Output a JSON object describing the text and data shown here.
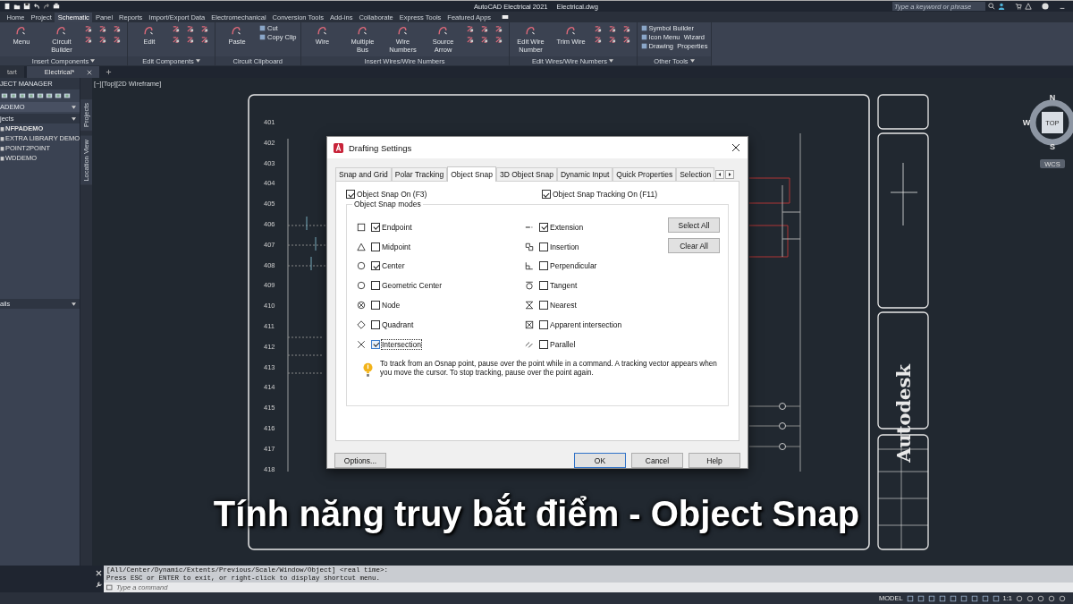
{
  "title_bar": {
    "app_title": "AutoCAD Electrical 2021",
    "file_name": "Electrical.dwg",
    "search": {
      "placeholder": "Type a keyword or phrase"
    }
  },
  "ribbon_tabs": [
    {
      "label": "Home",
      "selected": false
    },
    {
      "label": "Project",
      "selected": false
    },
    {
      "label": "Schematic",
      "selected": true
    },
    {
      "label": "Panel",
      "selected": false
    },
    {
      "label": "Reports",
      "selected": false
    },
    {
      "label": "Import/Export Data",
      "selected": false
    },
    {
      "label": "Electromechanical",
      "selected": false
    },
    {
      "label": "Conversion Tools",
      "selected": false
    },
    {
      "label": "Add-ins",
      "selected": false
    },
    {
      "label": "Collaborate",
      "selected": false
    },
    {
      "label": "Express Tools",
      "selected": false
    },
    {
      "label": "Featured Apps",
      "selected": false
    }
  ],
  "ribbon_panels": [
    {
      "title": "Insert Components",
      "menu": true,
      "tools": [
        {
          "kind": "large",
          "label": "Menu"
        },
        {
          "kind": "large",
          "label": "Circuit Builder"
        },
        {
          "kind": "grid"
        }
      ]
    },
    {
      "title": "Edit Components",
      "menu": true,
      "tools": [
        {
          "kind": "large",
          "label": "Edit"
        },
        {
          "kind": "grid"
        }
      ]
    },
    {
      "title": "Circuit Clipboard",
      "menu": false,
      "tools": [
        {
          "kind": "large",
          "label": "Paste"
        },
        {
          "kind": "stack",
          "items": [
            "Cut",
            "Copy Clip"
          ]
        }
      ]
    },
    {
      "title": "Insert Wires/Wire Numbers",
      "menu": false,
      "tools": [
        {
          "kind": "large",
          "label": "Wire"
        },
        {
          "kind": "large",
          "label": "Multiple Bus"
        },
        {
          "kind": "large",
          "label": "Wire Numbers"
        },
        {
          "kind": "large",
          "label": "Source Arrow"
        },
        {
          "kind": "grid"
        }
      ]
    },
    {
      "title": "Edit Wires/Wire Numbers",
      "menu": true,
      "tools": [
        {
          "kind": "large",
          "label": "Edit Wire Number"
        },
        {
          "kind": "large",
          "label": "Trim Wire"
        },
        {
          "kind": "grid"
        }
      ]
    },
    {
      "title": "Other Tools",
      "menu": true,
      "tools": [
        {
          "kind": "stack",
          "items": [
            "Symbol Builder",
            "Icon Menu  Wizard",
            "Drawing  Properties"
          ]
        }
      ]
    }
  ],
  "doc_tabs": [
    {
      "label": "tart",
      "selected": false
    },
    {
      "label": "Electrical*",
      "selected": true
    }
  ],
  "project_manager": {
    "title": "JECT MANAGER",
    "project": "ADEMO",
    "section": "jects",
    "projects": [
      {
        "label": "NFPADEMO",
        "selected": true
      },
      {
        "label": "EXTRA LIBRARY DEMO",
        "selected": false
      },
      {
        "label": "POINT2POINT",
        "selected": false
      },
      {
        "label": "WDDEMO",
        "selected": false
      }
    ],
    "details_title": "ails"
  },
  "side_tabs": [
    "Projects",
    "Location View"
  ],
  "viewport": {
    "label": "[−][Top][2D Wireframe]",
    "sheet_line_numbers": [
      "401",
      "402",
      "403",
      "404",
      "405",
      "406",
      "407",
      "408",
      "409",
      "410",
      "411",
      "412",
      "413",
      "414",
      "415",
      "416",
      "417",
      "418"
    ],
    "title_block_text": "Autodesk"
  },
  "view_cube": {
    "north": "N",
    "south": "S",
    "west": "W",
    "face": "TOP",
    "ucs": "WCS"
  },
  "dialog": {
    "title": "Drafting Settings",
    "tabs": [
      {
        "label": "Snap and Grid",
        "selected": false
      },
      {
        "label": "Polar Tracking",
        "selected": false
      },
      {
        "label": "Object Snap",
        "selected": true
      },
      {
        "label": "3D Object Snap",
        "selected": false
      },
      {
        "label": "Dynamic Input",
        "selected": false
      },
      {
        "label": "Quick Properties",
        "selected": false
      },
      {
        "label": "Selection",
        "selected": false
      }
    ],
    "snap_on": {
      "label": "Object Snap On (F3)",
      "checked": true
    },
    "tracking_on": {
      "label": "Object Snap Tracking On (F11)",
      "checked": true
    },
    "group_title": "Object Snap modes",
    "modes": [
      {
        "kind": "endpoint",
        "label": "Endpoint",
        "checked": true,
        "focused": false
      },
      {
        "kind": "midpoint",
        "label": "Midpoint",
        "checked": false,
        "focused": false
      },
      {
        "kind": "center",
        "label": "Center",
        "checked": true,
        "focused": false
      },
      {
        "kind": "geometric",
        "label": "Geometric Center",
        "checked": false,
        "focused": false
      },
      {
        "kind": "node",
        "label": "Node",
        "checked": false,
        "focused": false
      },
      {
        "kind": "quadrant",
        "label": "Quadrant",
        "checked": false,
        "focused": false
      },
      {
        "kind": "intersection",
        "label": "Intersection",
        "checked": true,
        "focused": true
      },
      {
        "kind": "extension",
        "label": "Extension",
        "checked": true,
        "focused": false
      },
      {
        "kind": "insertion",
        "label": "Insertion",
        "checked": false,
        "focused": false
      },
      {
        "kind": "perpendicular",
        "label": "Perpendicular",
        "checked": false,
        "focused": false
      },
      {
        "kind": "tangent",
        "label": "Tangent",
        "checked": false,
        "focused": false
      },
      {
        "kind": "nearest",
        "label": "Nearest",
        "checked": false,
        "focused": false
      },
      {
        "kind": "apparent",
        "label": "Apparent intersection",
        "checked": false,
        "focused": false
      },
      {
        "kind": "parallel",
        "label": "Parallel",
        "checked": false,
        "focused": false
      }
    ],
    "side_buttons": [
      "Select All",
      "Clear All"
    ],
    "hint": "To track from an Osnap point, pause over the point while in a command.  A tracking vector appears when you move the cursor.  To stop tracking, pause over the point again.",
    "footer_buttons": [
      {
        "label": "Options...",
        "default": false
      },
      {
        "label": "OK",
        "default": true
      },
      {
        "label": "Cancel",
        "default": false
      },
      {
        "label": "Help",
        "default": false
      }
    ]
  },
  "command_line": {
    "history": [
      "[All/Center/Dynamic/Extents/Previous/Scale/Window/Object] <real time>:",
      "Press ESC or ENTER to exit, or right-click to display shortcut menu."
    ],
    "placeholder": "Type a command"
  },
  "status_bar": {
    "space": "MODEL",
    "scale": "1:1"
  },
  "caption": "Tính năng truy bắt điểm - Object Snap"
}
